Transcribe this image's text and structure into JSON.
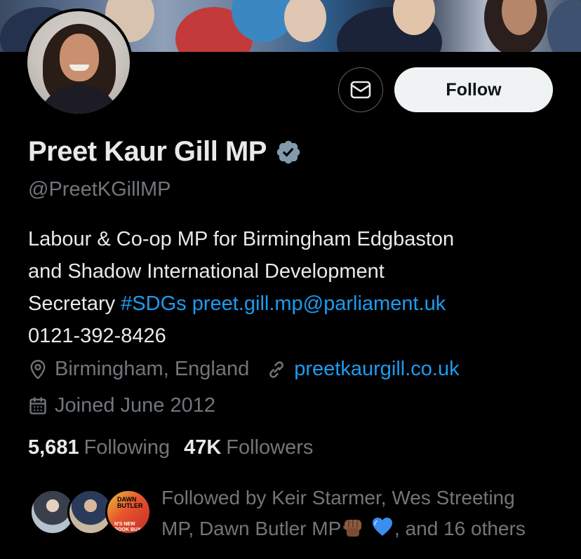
{
  "profile": {
    "name": "Preet Kaur Gill MP",
    "handle": "@PreetKGillMP",
    "bio_line1": "Labour & Co-op MP for Birmingham Edgbaston",
    "bio_line2": "and Shadow International Development",
    "bio_line3_text": "Secretary ",
    "bio_hashtag": "#SDGs",
    "bio_email": "preet.gill.mp@parliament.uk",
    "bio_phone": "0121-392-8426",
    "location": "Birmingham, England",
    "website": "preetkaurgill.co.uk",
    "joined": "Joined June 2012"
  },
  "actions": {
    "follow_label": "Follow"
  },
  "stats": {
    "following_count": "5,681",
    "following_label": "Following",
    "followers_count": "47K",
    "followers_label": "Followers"
  },
  "followed_by": {
    "line1": "Followed by Keir Starmer, Wes Streeting",
    "line2_prefix": "MP, Dawn Butler MP",
    "line2_suffix": ", and 16 others",
    "avatar3_top": "DAWN BUTLER",
    "avatar3_bottom": "N'S NEW BOOK BUY TODAY"
  },
  "colors": {
    "background": "#000000",
    "text_primary": "#e7e9ea",
    "text_secondary": "#71767b",
    "link": "#1d9bf0",
    "verified_badge": "#829aab",
    "follow_button_bg": "#eff3f4"
  },
  "icons": {
    "message": "envelope-icon",
    "verified": "verified-badge-icon",
    "location": "location-pin-icon",
    "website": "link-icon",
    "joined": "calendar-icon",
    "emoji1": "raised-fist-emoji",
    "emoji2": "blue-heart-emoji"
  }
}
